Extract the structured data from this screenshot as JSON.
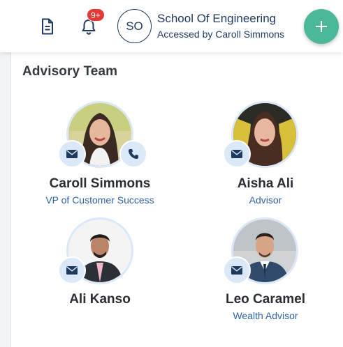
{
  "header": {
    "document_icon": "document-icon",
    "bell_icon": "bell-icon",
    "notification_count": "9+",
    "org_initials": "SO",
    "org_name": "School Of Engineering",
    "accessed_by": "Accessed by Caroll Simmons",
    "add_icon": "plus-icon"
  },
  "section": {
    "title": "Advisory Team"
  },
  "team": [
    {
      "name": "Caroll Simmons",
      "title": "VP of Customer Success",
      "actions": [
        "email",
        "phone"
      ]
    },
    {
      "name": "Aisha Ali",
      "title": "Advisor",
      "actions": [
        "email"
      ]
    },
    {
      "name": "Ali Kanso",
      "title": "",
      "actions": [
        "email"
      ]
    },
    {
      "name": "Leo Caramel",
      "title": "Wealth Advisor",
      "actions": [
        "email"
      ]
    }
  ],
  "colors": {
    "brand_navy": "#1f3a5f",
    "fab_green": "#4cb89a",
    "badge_red": "#e53935",
    "link_blue": "#2f62a3",
    "action_bg": "#dbe8f7"
  }
}
